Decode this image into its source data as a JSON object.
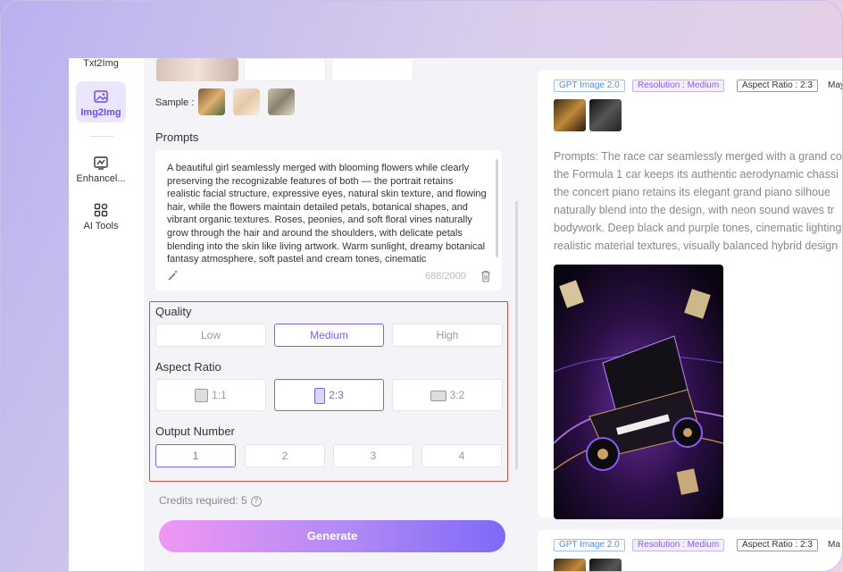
{
  "sidebar": {
    "items": [
      {
        "label": "Txt2Img",
        "icon": "text-image-icon"
      },
      {
        "label": "Img2Img",
        "icon": "image-edit-icon"
      },
      {
        "label": "Enhancel...",
        "icon": "enhance-icon"
      },
      {
        "label": "AI Tools",
        "icon": "tools-icon"
      }
    ]
  },
  "panel": {
    "sample_label": "Sample :",
    "prompts_label": "Prompts",
    "prompt_text": "A beautiful girl seamlessly merged with blooming flowers while clearly preserving the recognizable features of both — the portrait retains realistic facial structure, expressive eyes, natural skin texture, and flowing hair, while the flowers maintain detailed petals, botanical shapes, and vibrant organic textures. Roses, peonies, and soft floral vines naturally grow through the hair and around the shoulders, with delicate petals blending into the skin like living artwork. Warm sunlight, dreamy botanical fantasy atmosphere, soft pastel and cream tones, cinematic",
    "char_count": "688/2000",
    "quality": {
      "label": "Quality",
      "options": [
        "Low",
        "Medium",
        "High"
      ],
      "selected": "Medium"
    },
    "aspect_ratio": {
      "label": "Aspect Ratio",
      "options": [
        "1:1",
        "2:3",
        "3:2"
      ],
      "selected": "2:3"
    },
    "output_number": {
      "label": "Output Number",
      "options": [
        "1",
        "2",
        "3",
        "4"
      ],
      "selected": "1"
    },
    "credits_label": "Credits required: 5",
    "help_glyph": "?",
    "generate_label": "Generate"
  },
  "results": {
    "cards": [
      {
        "tags": {
          "model": "GPT Image 2.0",
          "resolution": "Resolution : Medium",
          "ratio": "Aspect Ratio : 2:3",
          "more": "May"
        },
        "prompt_lines": [
          "Prompts: The race car seamlessly merged with a grand co",
          "the Formula 1 car keeps its authentic aerodynamic chassi",
          "the concert piano retains its elegant grand piano silhoue",
          "naturally blend into the design, with neon sound waves tr",
          "bodywork. Deep black and purple tones, cinematic lighting",
          "realistic material textures, visually balanced hybrid design"
        ]
      },
      {
        "tags": {
          "model": "GPT Image 2.0",
          "resolution": "Resolution : Medium",
          "ratio": "Aspect Ratio : 2:3",
          "more": "Ma"
        }
      }
    ]
  },
  "colors": {
    "accent": "#7b62f6",
    "highlight_box": "#e44a3c",
    "model_tag": "#4a90e2",
    "resolution_tag": "#8a5cf6"
  }
}
